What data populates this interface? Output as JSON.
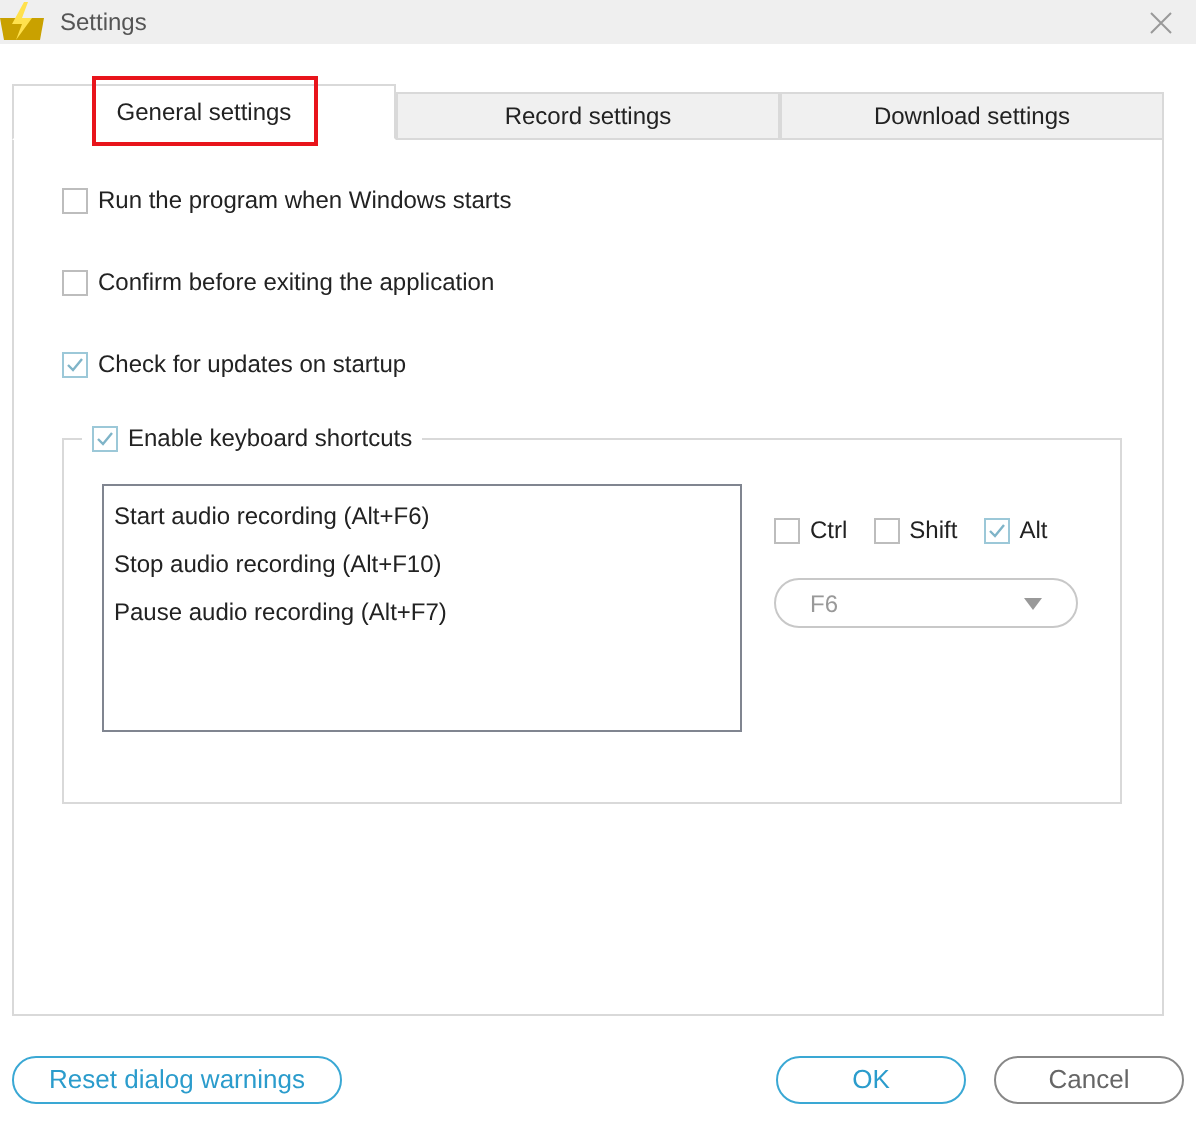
{
  "window": {
    "title": "Settings"
  },
  "tabs": [
    {
      "label": "General settings",
      "selected": true,
      "highlighted": true
    },
    {
      "label": "Record settings",
      "selected": false,
      "highlighted": false
    },
    {
      "label": "Download settings",
      "selected": false,
      "highlighted": false
    }
  ],
  "options": [
    {
      "label": "Run the program when Windows starts",
      "checked": false
    },
    {
      "label": "Confirm before exiting the application",
      "checked": false
    },
    {
      "label": "Check for updates on startup",
      "checked": true
    }
  ],
  "shortcuts": {
    "label": "Enable keyboard shortcuts",
    "checked": true,
    "actions": [
      "Start audio recording (Alt+F6)",
      "Stop audio recording (Alt+F10)",
      "Pause audio recording (Alt+F7)"
    ],
    "modifiers": [
      {
        "label": "Ctrl",
        "checked": false
      },
      {
        "label": "Shift",
        "checked": false
      },
      {
        "label": "Alt",
        "checked": true
      }
    ],
    "key": {
      "value": "F6",
      "disabled": true
    }
  },
  "buttons": [
    {
      "label": "Reset dialog warnings",
      "kind": "accent"
    },
    {
      "label": "OK",
      "kind": "accent"
    },
    {
      "label": "Cancel",
      "kind": "plain"
    }
  ]
}
